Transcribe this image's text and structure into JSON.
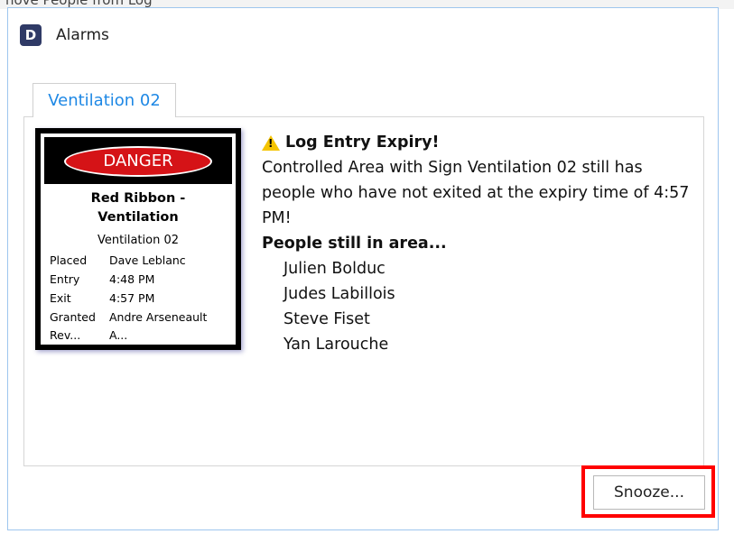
{
  "background_window": {
    "title_fragment": "nove People from Log"
  },
  "dialog": {
    "app_icon_letter": "D",
    "title": "Alarms"
  },
  "tabs": [
    {
      "label": "Ventilation 02",
      "active": true
    }
  ],
  "sign": {
    "header": "DANGER",
    "title_line1": "Red Ribbon -",
    "title_line2": "Ventilation",
    "subtitle": "Ventilation 02",
    "rows": [
      {
        "key": "Placed",
        "value": "Dave Leblanc"
      },
      {
        "key": "Entry",
        "value": "4:48 PM"
      },
      {
        "key": "Exit",
        "value": "4:57 PM"
      },
      {
        "key": "Granted",
        "value": "Andre Arseneault"
      },
      {
        "key": "Rev...",
        "value": "A..."
      }
    ]
  },
  "alarm": {
    "icon": "warning-icon",
    "heading": "Log Entry Expiry!",
    "message": "Controlled Area with Sign Ventilation 02 still has people who have not exited at the expiry time of 4:57 PM!",
    "people_label": "People still in area...",
    "people": [
      "Julien Bolduc",
      "Judes Labillois",
      "Steve Fiset",
      "Yan Larouche"
    ]
  },
  "buttons": {
    "snooze": "Snooze..."
  },
  "colors": {
    "accent": "#1e88e5",
    "danger": "#d51317",
    "highlight": "#ff0000",
    "warning": "#f5c400",
    "dialog_border": "#9ec6ee"
  }
}
